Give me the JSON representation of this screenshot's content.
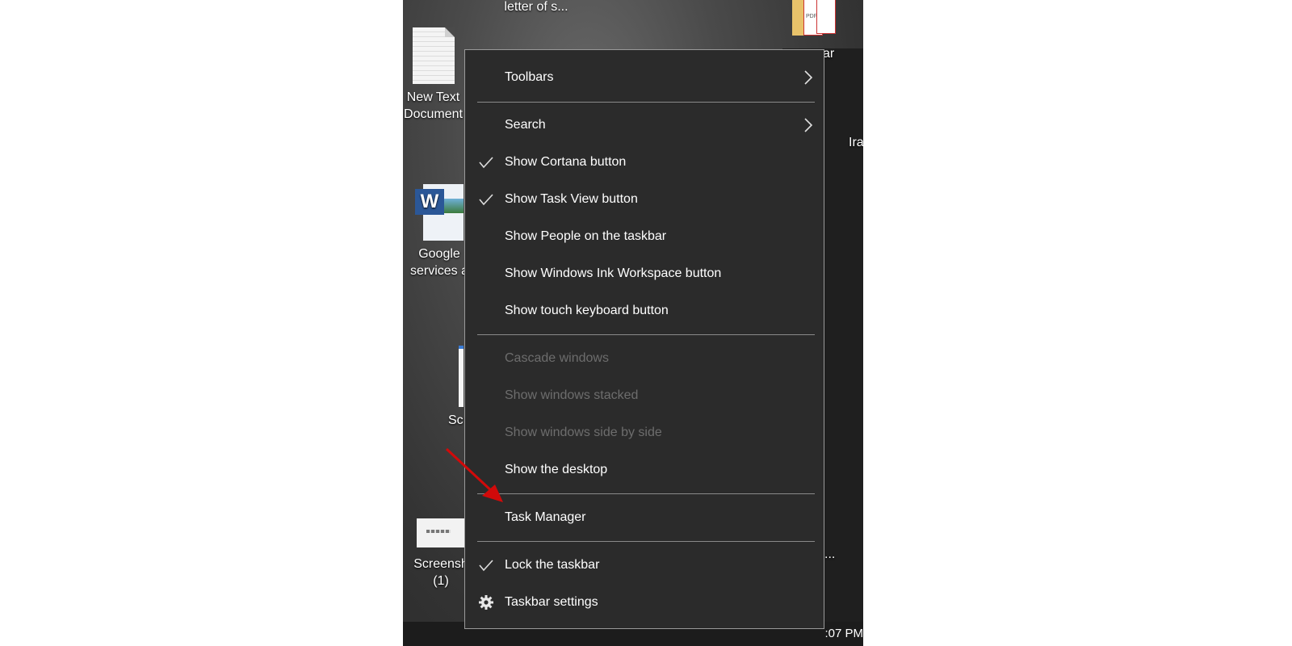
{
  "desktop": {
    "icons": [
      {
        "name": "letter-file",
        "label": "letter of s..."
      },
      {
        "name": "new-text-document",
        "label_line1": "New Text",
        "label_line2": "Document"
      },
      {
        "name": "google-services-doc",
        "label_line1": "Google",
        "label_line2": "services a"
      },
      {
        "name": "screenshot-partial",
        "label": "Sc"
      },
      {
        "name": "screenshot-1",
        "label_line1": "Screensh",
        "label_line2": "(1)"
      },
      {
        "name": "pdf-folder",
        "label": "ar"
      },
      {
        "name": "partial-right-label",
        "label": "Ira"
      },
      {
        "name": "partial-ellipsis",
        "label": "..."
      }
    ],
    "clock_partial": ":07 PM"
  },
  "context_menu": {
    "items": [
      {
        "label": "Toolbars",
        "checked": false,
        "submenu": true,
        "enabled": true
      },
      {
        "label": "Search",
        "checked": false,
        "submenu": true,
        "enabled": true
      },
      {
        "label": "Show Cortana button",
        "checked": true,
        "enabled": true
      },
      {
        "label": "Show Task View button",
        "checked": true,
        "enabled": true
      },
      {
        "label": "Show People on the taskbar",
        "checked": false,
        "enabled": true
      },
      {
        "label": "Show Windows Ink Workspace button",
        "checked": false,
        "enabled": true
      },
      {
        "label": "Show touch keyboard button",
        "checked": false,
        "enabled": true
      },
      {
        "label": "Cascade windows",
        "checked": false,
        "enabled": false
      },
      {
        "label": "Show windows stacked",
        "checked": false,
        "enabled": false
      },
      {
        "label": "Show windows side by side",
        "checked": false,
        "enabled": false
      },
      {
        "label": "Show the desktop",
        "checked": false,
        "enabled": true
      },
      {
        "label": "Task Manager",
        "checked": false,
        "enabled": true,
        "highlighted_by_arrow": true
      },
      {
        "label": "Lock the taskbar",
        "checked": true,
        "enabled": true
      },
      {
        "label": "Taskbar settings",
        "icon": "gear-icon",
        "enabled": true
      }
    ]
  },
  "colors": {
    "menu_bg": "#2b2b2b",
    "menu_text": "#ffffff",
    "disabled_text": "#6d6d6d",
    "annotation_arrow": "#d10a0a"
  }
}
